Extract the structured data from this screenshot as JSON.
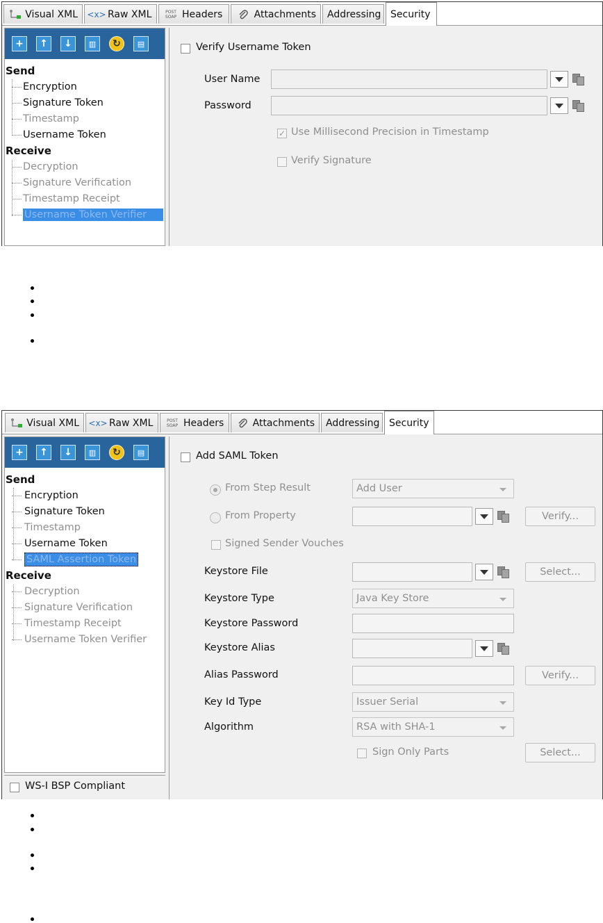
{
  "tabs": [
    {
      "label": "Visual XML",
      "icon": "visual-xml-icon"
    },
    {
      "label": "Raw XML",
      "icon": "raw-xml-icon",
      "icon_text": "<x>"
    },
    {
      "label": "Headers",
      "icon": "post-soap-icon",
      "icon_text": "POST SOAP"
    },
    {
      "label": "Attachments",
      "icon": "paperclip-icon"
    },
    {
      "label": "Addressing"
    },
    {
      "label": "Security"
    }
  ],
  "toolbar_icons": [
    "add-icon",
    "move-up-icon",
    "move-down-icon",
    "delete-icon",
    "refresh-icon",
    "save-icon"
  ],
  "panel1": {
    "tree": {
      "send_label": "Send",
      "send_items": [
        "Encryption",
        "Signature Token",
        "Timestamp",
        "Username Token"
      ],
      "receive_label": "Receive",
      "receive_items": [
        "Decryption",
        "Signature Verification",
        "Timestamp Receipt",
        "Username Token Verifier"
      ]
    },
    "form": {
      "verify_label": "Verify Username Token",
      "username_label": "User Name",
      "password_label": "Password",
      "millisecond_label": "Use Millisecond Precision in Timestamp",
      "verify_signature_label": "Verify Signature"
    }
  },
  "panel2": {
    "tree": {
      "send_label": "Send",
      "send_items": [
        "Encryption",
        "Signature Token",
        "Timestamp",
        "Username Token",
        "SAML Assertion Token"
      ],
      "receive_label": "Receive",
      "receive_items": [
        "Decryption",
        "Signature Verification",
        "Timestamp Receipt",
        "Username Token Verifier"
      ]
    },
    "wsi_label": "WS-I BSP Compliant",
    "form": {
      "add_saml_label": "Add SAML Token",
      "from_step_label": "From Step Result",
      "from_step_value": "Add User",
      "from_property_label": "From Property",
      "verify_button": "Verify...",
      "signed_sender_label": "Signed Sender Vouches",
      "keystore_file_label": "Keystore File",
      "select_button": "Select...",
      "keystore_type_label": "Keystore Type",
      "keystore_type_value": "Java Key Store",
      "keystore_password_label": "Keystore Password",
      "keystore_alias_label": "Keystore Alias",
      "alias_password_label": "Alias Password",
      "key_id_type_label": "Key Id Type",
      "key_id_type_value": "Issuer Serial",
      "algorithm_label": "Algorithm",
      "algorithm_value": "RSA with SHA-1",
      "sign_only_parts_label": "Sign Only Parts"
    }
  }
}
